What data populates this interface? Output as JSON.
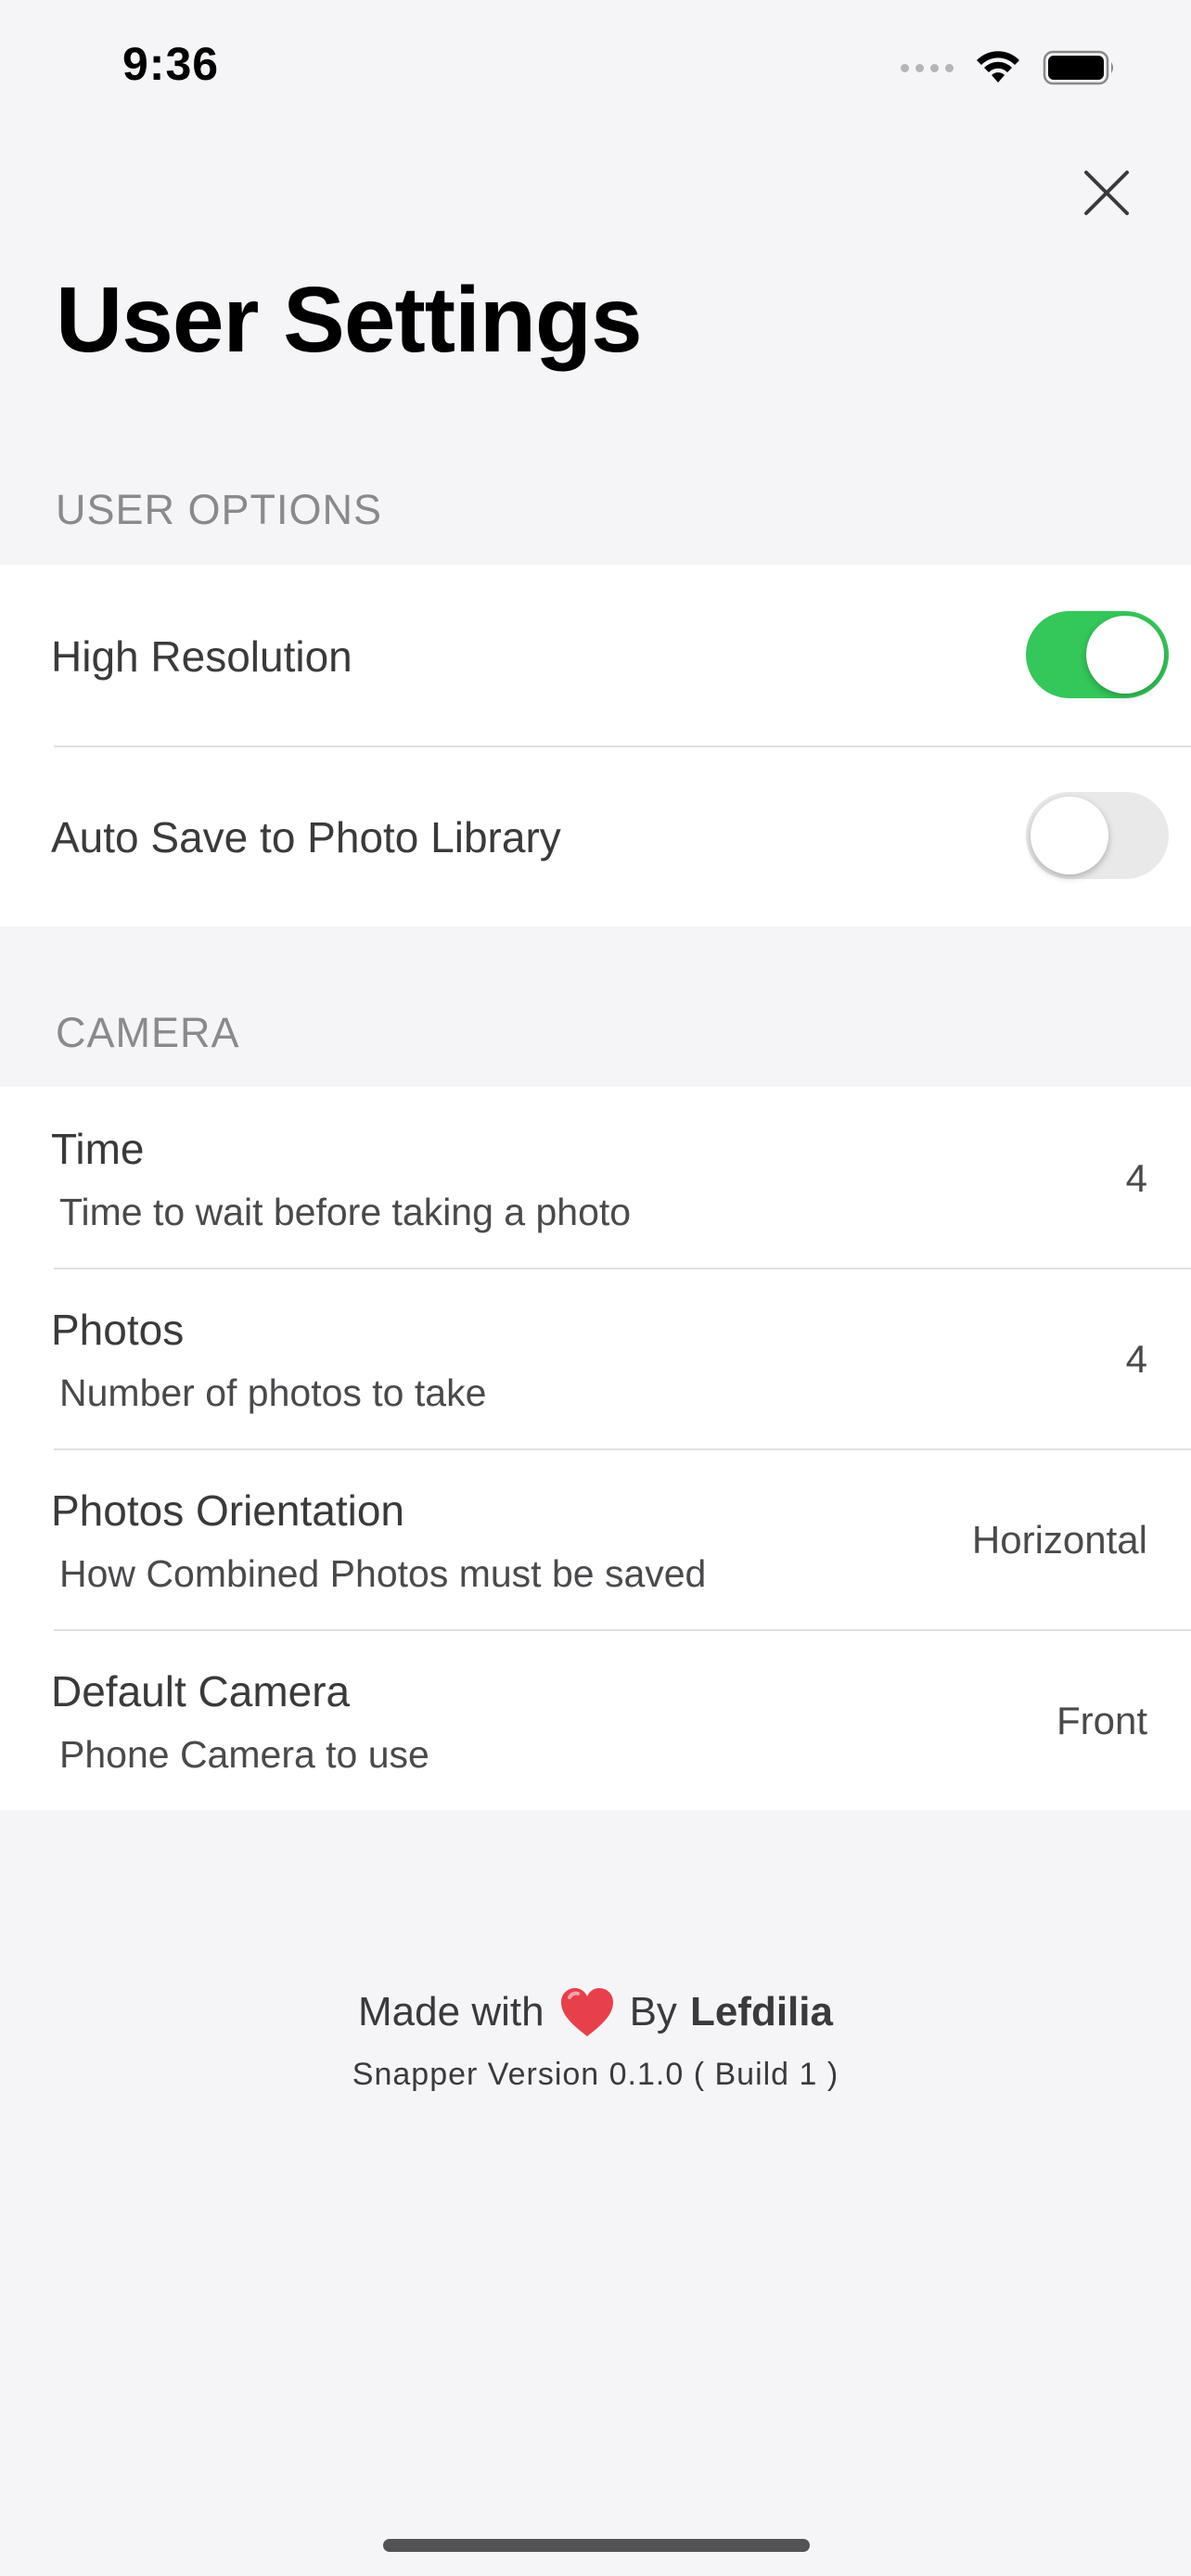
{
  "status_bar": {
    "time": "9:36",
    "signal_icon": "signal-dots-icon",
    "wifi_icon": "wifi-icon",
    "battery_icon": "battery-icon"
  },
  "header": {
    "close_icon": "close-icon",
    "title": "User Settings"
  },
  "sections": {
    "user_options": {
      "header": "USER OPTIONS",
      "rows": [
        {
          "title": "High Resolution",
          "toggle_on": true
        },
        {
          "title": "Auto Save to Photo Library",
          "toggle_on": false
        }
      ]
    },
    "camera": {
      "header": "CAMERA",
      "rows": [
        {
          "title": "Time",
          "subtitle": "Time to wait before taking a photo",
          "value": "4"
        },
        {
          "title": "Photos",
          "subtitle": "Number of photos to take",
          "value": "4"
        },
        {
          "title": "Photos Orientation",
          "subtitle": "How Combined Photos must be saved",
          "value": "Horizontal"
        },
        {
          "title": "Default Camera",
          "subtitle": "Phone Camera to use",
          "value": "Front"
        }
      ]
    }
  },
  "footer": {
    "made_with": "Made with",
    "heart_icon": "heart-icon",
    "by": "By",
    "author": "Lefdilia",
    "version": "Snapper Version 0.1.0 ( Build 1 )"
  },
  "colors": {
    "background": "#f5f5f7",
    "toggle_on": "#34c759",
    "toggle_off": "#e9e9ea",
    "heart": "#e8404a",
    "section_header": "#8a8a8e"
  }
}
